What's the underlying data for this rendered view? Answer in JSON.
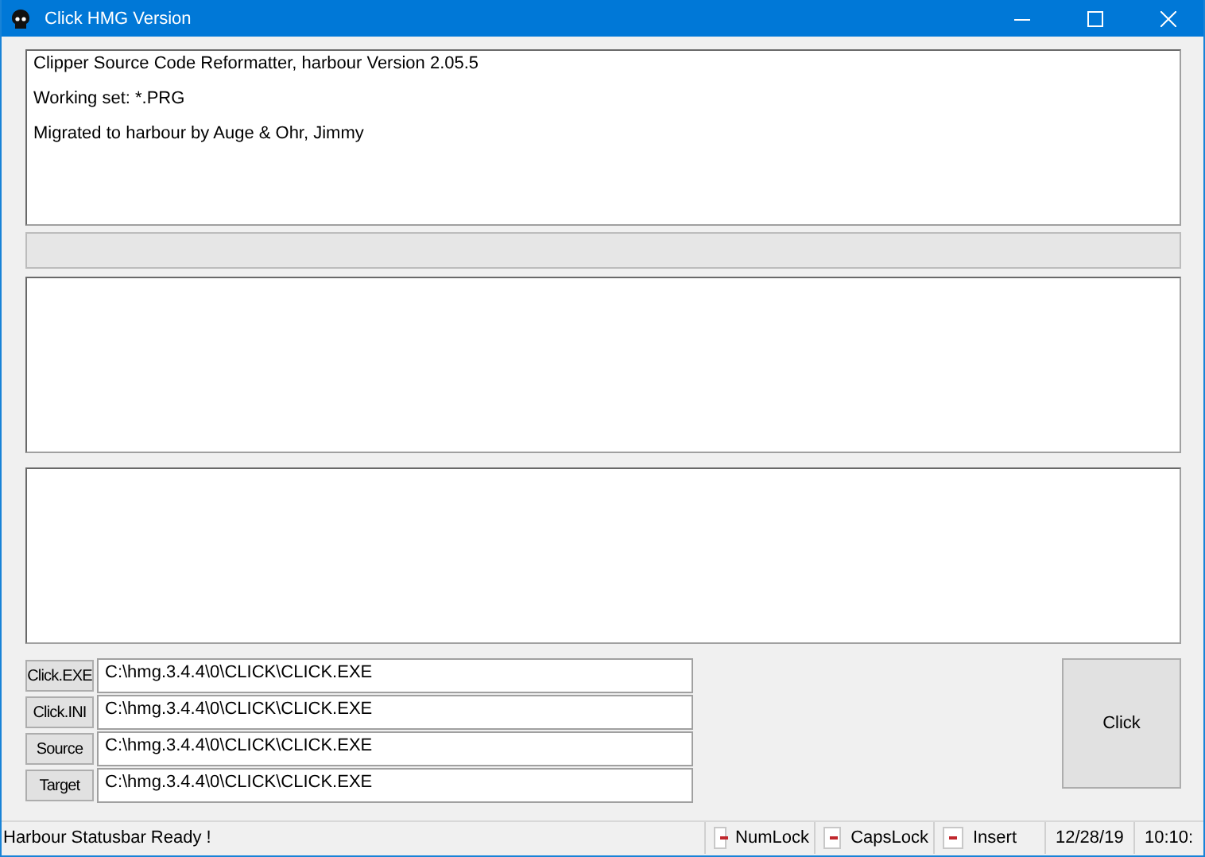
{
  "window": {
    "title": "Click HMG Version"
  },
  "info_box": {
    "lines": [
      "Clipper Source Code Reformatter,  harbour Version 2.05.5",
      "Working set: *.PRG",
      "Migrated to harbour by Auge & Ohr, Jimmy"
    ]
  },
  "progress": {
    "level": 0
  },
  "file_rows": [
    {
      "button": "Click.EXE",
      "value": "C:\\hmg.3.4.4\\0\\CLICK\\CLICK.EXE"
    },
    {
      "button": "Click.INI",
      "value": "C:\\hmg.3.4.4\\0\\CLICK\\CLICK.EXE"
    },
    {
      "button": "Source",
      "value": "C:\\hmg.3.4.4\\0\\CLICK\\CLICK.EXE"
    },
    {
      "button": "Target",
      "value": "C:\\hmg.3.4.4\\0\\CLICK\\CLICK.EXE"
    }
  ],
  "run_button": "Click",
  "status_bar": {
    "message": "Harbour Statusbar Ready !",
    "keys": [
      {
        "label": "NumLock",
        "on": false
      },
      {
        "label": "CapsLock",
        "on": false
      },
      {
        "label": "Insert",
        "on": false
      }
    ],
    "date": "12/28/19",
    "time": "10:10:"
  }
}
